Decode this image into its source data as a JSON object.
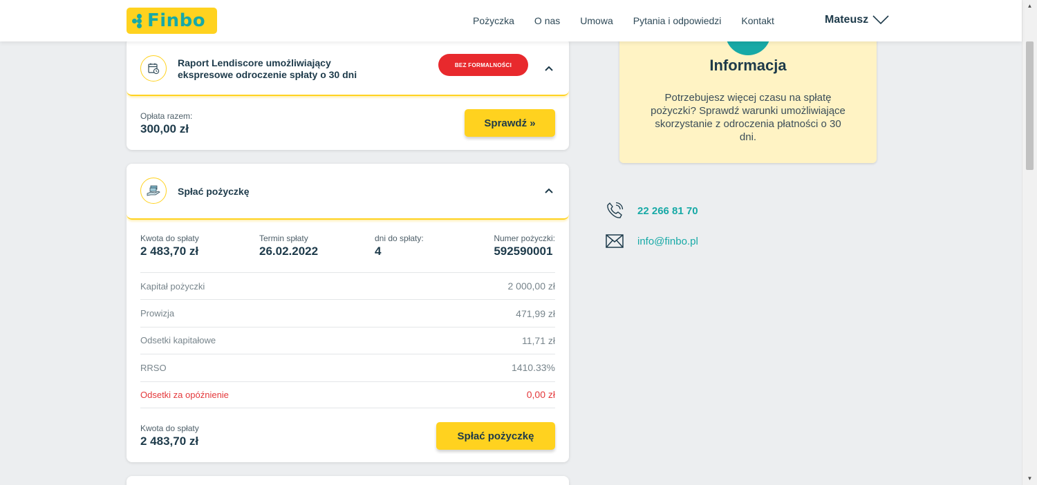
{
  "header": {
    "logo_text": "Finbo",
    "nav": [
      "Pożyczka",
      "O nas",
      "Umowa",
      "Pytania i odpowiedzi",
      "Kontakt"
    ],
    "user_name": "Mateusz"
  },
  "raport_card": {
    "title_line1": "Raport Lendiscore umożliwiający",
    "title_line2": "ekspresowe odroczenie spłaty o 30 dni",
    "badge": "BEZ FORMALNOŚCI",
    "fee_label": "Opłata razem:",
    "fee_value": "300,00 zł",
    "button": "Sprawdź »"
  },
  "loan_card": {
    "title": "Spłać pożyczkę",
    "summary": [
      {
        "label": "Kwota do spłaty",
        "value": "2 483,70 zł"
      },
      {
        "label": "Termin spłaty",
        "value": "26.02.2022"
      },
      {
        "label": "dni do spłaty:",
        "value": "4"
      },
      {
        "label": "Numer pożyczki:",
        "value": "592590001"
      }
    ],
    "rows": [
      {
        "label": "Kapitał pożyczki",
        "value": "2 000,00 zł"
      },
      {
        "label": "Prowizja",
        "value": "471,99 zł"
      },
      {
        "label": "Odsetki kapitałowe",
        "value": "11,71 zł"
      },
      {
        "label": "RRSO",
        "value": "1410.33%"
      },
      {
        "label": "Odsetki za opóźnienie",
        "value": "0,00 zł"
      }
    ],
    "total_label": "Kwota do spłaty",
    "total_value": "2 483,70 zł",
    "button": "Spłać pożyczkę"
  },
  "info": {
    "title": "Informacja",
    "text": "Potrzebujesz więcej czasu na spłatę pożyczki? Sprawdź warunki umożliwiające skorzystanie z odroczenia płatności o 30 dni."
  },
  "contact": {
    "phone": "22 266 81 70",
    "email": "info@finbo.pl"
  },
  "colors": {
    "brand_yellow": "#ffd21f",
    "brand_teal": "#17a9a6",
    "danger": "#e8292d"
  },
  "icons": [
    "calendar-clock-icon",
    "money-hand-icon",
    "chevron-up-icon",
    "chevron-down-icon",
    "phone-icon",
    "mail-icon"
  ]
}
